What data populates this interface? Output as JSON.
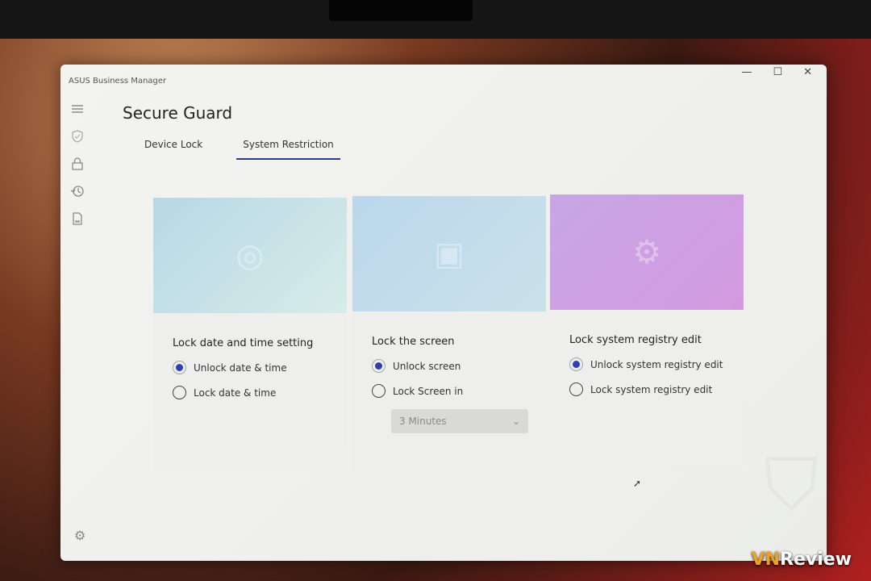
{
  "app_title": "ASUS Business Manager",
  "window_controls": {
    "minimize": "—",
    "maximize": "☐",
    "close": "✕"
  },
  "page_title": "Secure Guard",
  "tabs": [
    {
      "label": "Device Lock",
      "active": false
    },
    {
      "label": "System Restriction",
      "active": true
    }
  ],
  "sidebar": {
    "icons": [
      "menu-icon",
      "shield-check-icon",
      "lock-icon",
      "history-icon",
      "document-icon"
    ],
    "footer_icon": "gear-icon"
  },
  "colors": {
    "accent": "#2f3eb0",
    "tab_underline": "#2e3a8c"
  },
  "cards": [
    {
      "heading": "Lock date and time setting",
      "options": [
        {
          "label": "Unlock date & time",
          "selected": true
        },
        {
          "label": "Lock date & time",
          "selected": false
        }
      ]
    },
    {
      "heading": "Lock the screen",
      "options": [
        {
          "label": "Unlock screen",
          "selected": true
        },
        {
          "label": "Lock Screen in",
          "selected": false
        }
      ],
      "dropdown": {
        "value": "3 Minutes",
        "disabled": true
      }
    },
    {
      "heading": "Lock system registry edit",
      "options": [
        {
          "label": "Unlock system registry edit",
          "selected": true
        },
        {
          "label": "Lock system registry edit",
          "selected": false
        }
      ]
    }
  ],
  "watermark": {
    "brand_prefix": "VN",
    "brand": "Review"
  }
}
